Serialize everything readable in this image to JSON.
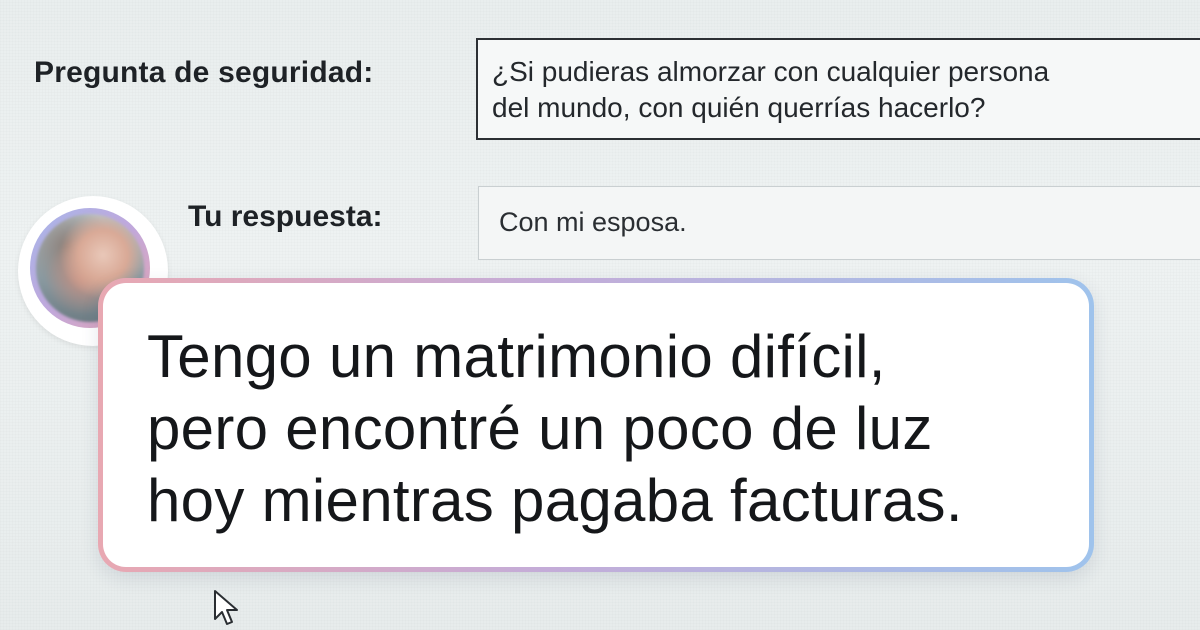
{
  "security": {
    "question_label": "Pregunta de seguridad:",
    "question_lines": [
      "¿Si pudieras almorzar con cualquier persona",
      "del mundo, con quién querrías hacerlo?"
    ],
    "answer_label": "Tu respuesta:",
    "answer_value": "Con mi esposa."
  },
  "quote": {
    "lines": [
      "Tengo un matrimonio difícil,",
      "pero encontré un poco de luz",
      "hoy mientras pagaba facturas."
    ]
  },
  "colors": {
    "card_gradient_start": "#e8a8b2",
    "card_gradient_mid": "#c4acd8",
    "card_gradient_end": "#9fc3ec",
    "text_dark": "#15171a"
  },
  "icons": {
    "cursor": "mouse-pointer-icon",
    "avatar": "user-avatar"
  }
}
